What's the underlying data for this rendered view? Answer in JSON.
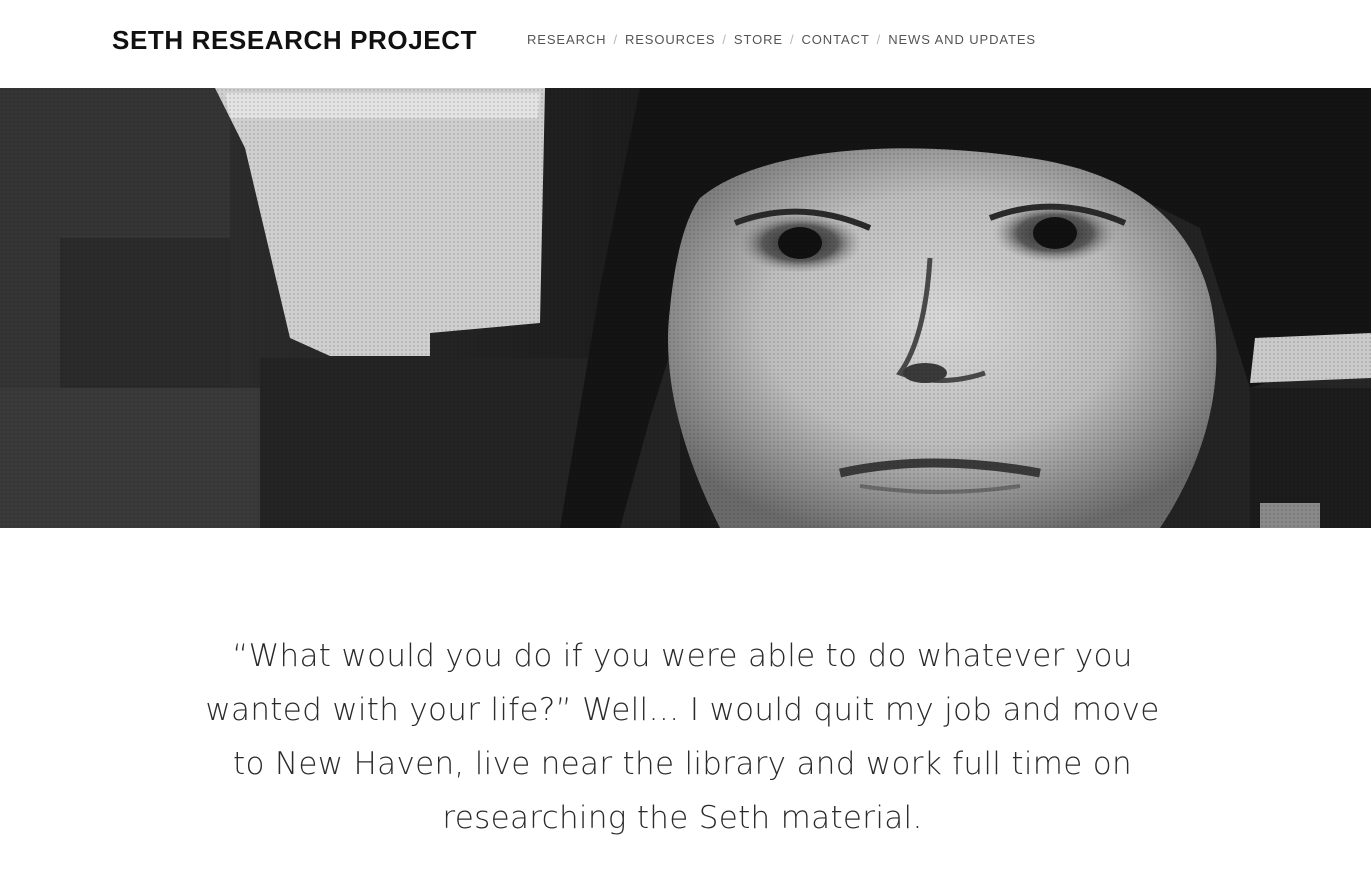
{
  "header": {
    "site_title": "SETH RESEARCH PROJECT",
    "nav": [
      {
        "label": "RESEARCH"
      },
      {
        "label": "RESOURCES"
      },
      {
        "label": "STORE"
      },
      {
        "label": "CONTACT"
      },
      {
        "label": "NEWS AND UPDATES"
      }
    ],
    "nav_separator": "/"
  },
  "hero": {
    "image": "black-and-white-portrait-photo"
  },
  "quote": {
    "text": "“What would you do if you were able to do whatever you wanted with your life?” Well… I would quit my job and move to New Haven, live near the library and work full time on researching the Seth material."
  },
  "colors": {
    "text_dark": "#111111",
    "nav_text": "#555555",
    "background": "#ffffff"
  }
}
